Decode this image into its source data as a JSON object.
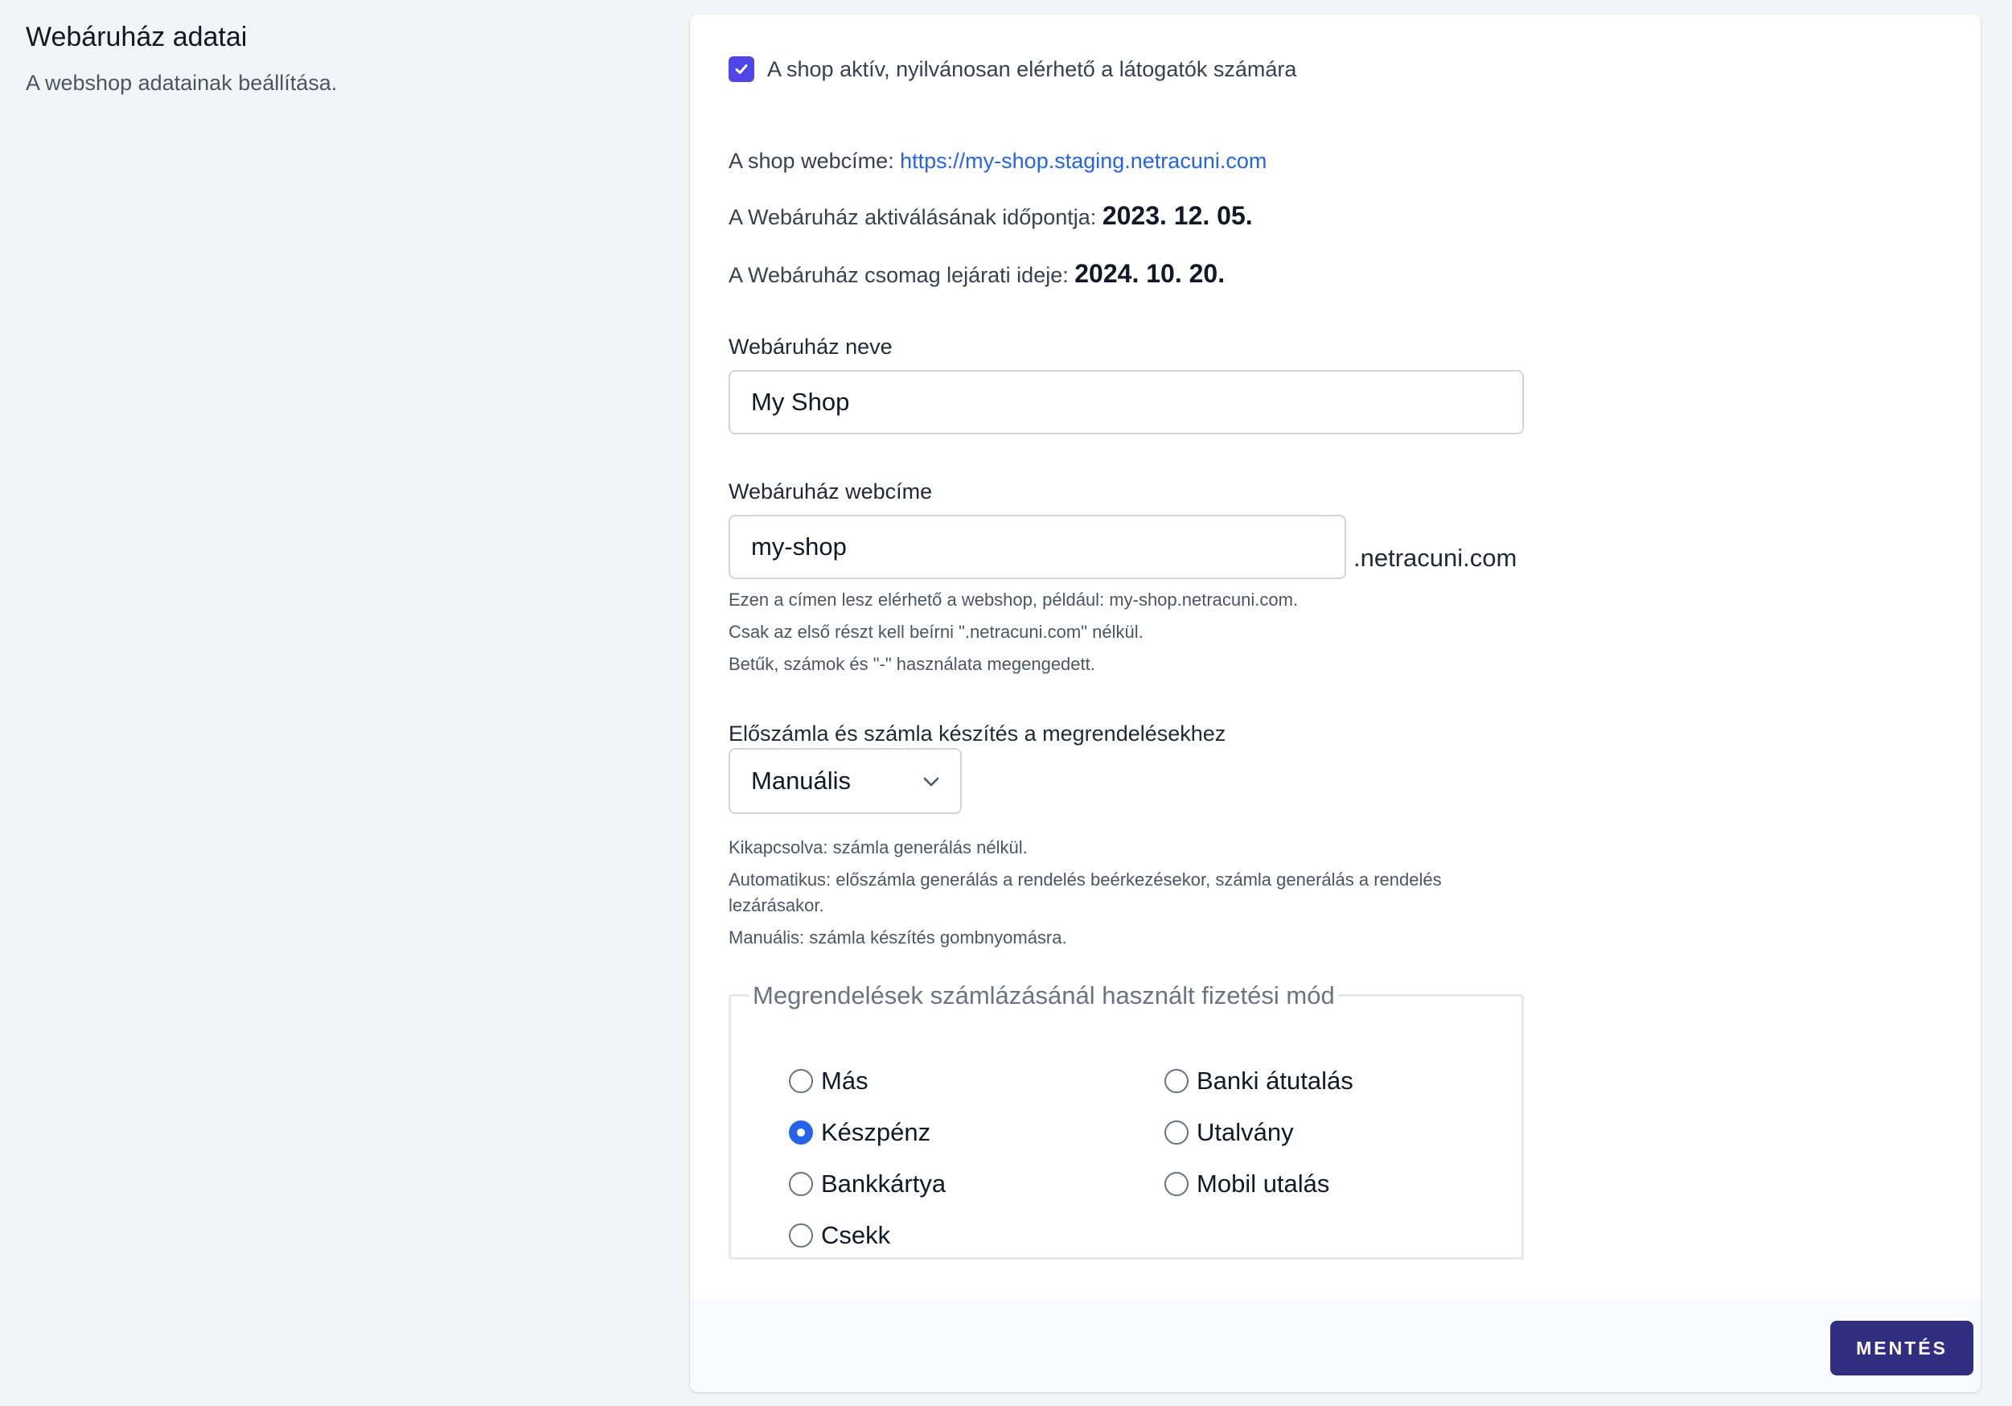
{
  "section": {
    "title": "Webáruház adatai",
    "description": "A webshop adatainak beállítása."
  },
  "shop_active": {
    "checked": true,
    "label": "A shop aktív, nyilvánosan elérhető a látogatók számára"
  },
  "info": {
    "url_label": "A shop webcíme:",
    "url_value": "https://my-shop.staging.netracuni.com",
    "activation_label": "A Webáruház aktiválásának időpontja:",
    "activation_value": "2023. 12. 05.",
    "expiry_label": "A Webáruház csomag lejárati ideje:",
    "expiry_value": "2024. 10. 20."
  },
  "shop_name": {
    "label": "Webáruház neve",
    "value": "My Shop"
  },
  "shop_domain": {
    "label": "Webáruház webcíme",
    "value": "my-shop",
    "suffix": ".netracuni.com",
    "help": [
      "Ezen a címen lesz elérhető a webshop, például: my-shop.netracuni.com.",
      "Csak az első részt kell beírni \".netracuni.com\" nélkül.",
      "Betűk, számok és \"-\" használata megengedett."
    ]
  },
  "invoicing": {
    "label": "Előszámla és számla készítés a megrendelésekhez",
    "selected": "Manuális",
    "help": [
      "Kikapcsolva: számla generálás nélkül.",
      "Automatikus: előszámla generálás a rendelés beérkezésekor, számla generálás a rendelés lezárásakor.",
      "Manuális: számla készítés gombnyomásra."
    ]
  },
  "payment_method": {
    "legend": "Megrendelések számlázásánál használt fizetési mód",
    "options": [
      {
        "label": "Más",
        "checked": false
      },
      {
        "label": "Banki átutalás",
        "checked": false
      },
      {
        "label": "Készpénz",
        "checked": true
      },
      {
        "label": "Utalvány",
        "checked": false
      },
      {
        "label": "Bankkártya",
        "checked": false
      },
      {
        "label": "Mobil utalás",
        "checked": false
      },
      {
        "label": "Csekk",
        "checked": false
      }
    ]
  },
  "footer": {
    "save_label": "MENTÉS"
  },
  "colors": {
    "primary": "#4f46e5",
    "link": "#2563eb",
    "radio_selected": "#2563eb",
    "save_button": "#312e81",
    "page_background": "#f3f4f6"
  },
  "icons": {
    "checkbox": "checkmark-icon",
    "select": "chevron-down-icon"
  }
}
